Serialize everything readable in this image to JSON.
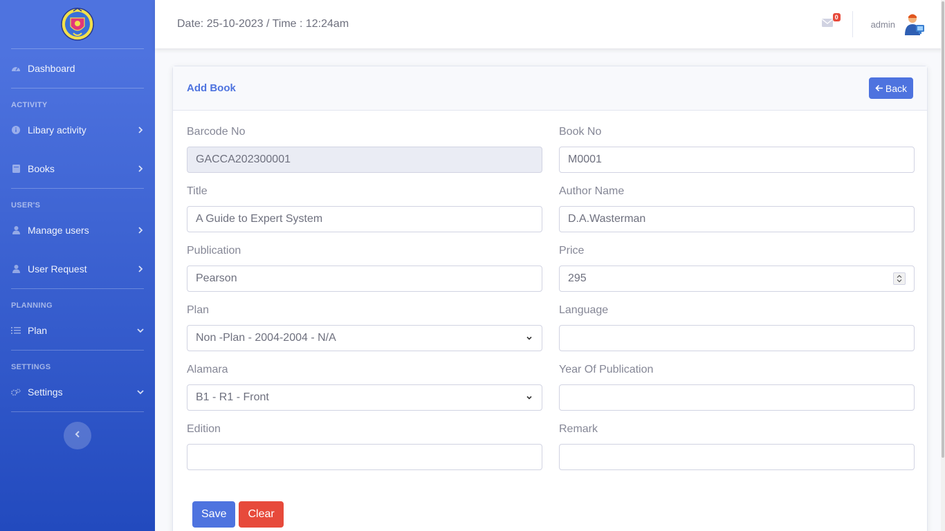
{
  "sidebar": {
    "logo_icon": "college-crest-logo",
    "items": {
      "dashboard": {
        "label": "Dashboard",
        "icon": "tachometer-icon"
      },
      "library_activity": {
        "label": "Libary activity",
        "icon": "info-circle-icon"
      },
      "books": {
        "label": "Books",
        "icon": "book-icon"
      },
      "manage_users": {
        "label": "Manage users",
        "icon": "user-icon"
      },
      "user_request": {
        "label": "User Request",
        "icon": "user-icon"
      },
      "plan": {
        "label": "Plan",
        "icon": "list-icon"
      },
      "settings": {
        "label": "Settings",
        "icon": "cogs-icon"
      }
    },
    "headings": {
      "activity": "ACTIVITY",
      "users": "USER'S",
      "planning": "PLANNING",
      "settings": "SETTINGS"
    }
  },
  "topbar": {
    "datetime": "Date: 25-10-2023 / Time : 12:24am",
    "mail_count": "0",
    "username": "admin"
  },
  "card": {
    "title": "Add Book",
    "back_label": "Back"
  },
  "form": {
    "barcode": {
      "label": "Barcode No",
      "value": "GACCA202300001"
    },
    "book_no": {
      "label": "Book No",
      "value": "M0001"
    },
    "title": {
      "label": "Title",
      "value": "A Guide to Expert System"
    },
    "author": {
      "label": "Author Name",
      "value": "D.A.Wasterman"
    },
    "publication": {
      "label": "Publication",
      "value": "Pearson"
    },
    "price": {
      "label": "Price",
      "value": "295"
    },
    "plan": {
      "label": "Plan",
      "value": "Non -Plan - 2004-2004 - N/A"
    },
    "language": {
      "label": "Language",
      "value": ""
    },
    "alamara": {
      "label": "Alamara",
      "value": "B1 - R1 - Front"
    },
    "year": {
      "label": "Year Of Publication",
      "value": ""
    },
    "edition": {
      "label": "Edition",
      "value": ""
    },
    "remark": {
      "label": "Remark",
      "value": ""
    }
  },
  "actions": {
    "save_label": "Save",
    "clear_label": "Clear"
  },
  "colors": {
    "primary": "#4e73df",
    "danger": "#e74a3b",
    "sidebar_bottom": "#224abe"
  }
}
